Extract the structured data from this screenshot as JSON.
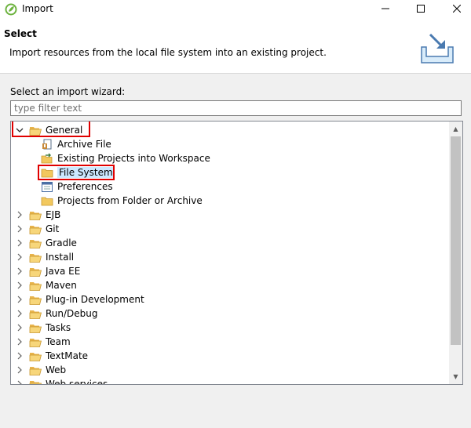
{
  "window": {
    "title": "Import",
    "minimize_icon": "minimize-icon",
    "maximize_icon": "maximize-icon",
    "close_icon": "close-icon"
  },
  "header": {
    "title": "Select",
    "description": "Import resources from the local file system into an existing project.",
    "icon": "import-wizard-banner-icon"
  },
  "wizard": {
    "label": "Select an import wizard:",
    "filter_placeholder": "type filter text"
  },
  "tree": {
    "general": {
      "label": "General",
      "expanded": true,
      "children": [
        {
          "label": "Archive File",
          "icon": "archive-file-icon"
        },
        {
          "label": "Existing Projects into Workspace",
          "icon": "existing-projects-icon"
        },
        {
          "label": "File System",
          "icon": "file-system-folder-icon",
          "selected": true
        },
        {
          "label": "Preferences",
          "icon": "preferences-icon"
        },
        {
          "label": "Projects from Folder or Archive",
          "icon": "folder-icon"
        }
      ]
    },
    "categories": [
      "EJB",
      "Git",
      "Gradle",
      "Install",
      "Java EE",
      "Maven",
      "Plug-in Development",
      "Run/Debug",
      "Tasks",
      "Team",
      "TextMate",
      "Web",
      "Web services"
    ]
  },
  "colors": {
    "selection": "#cce8ff",
    "highlight_box": "#e00000",
    "folder": "#e8b44c"
  }
}
